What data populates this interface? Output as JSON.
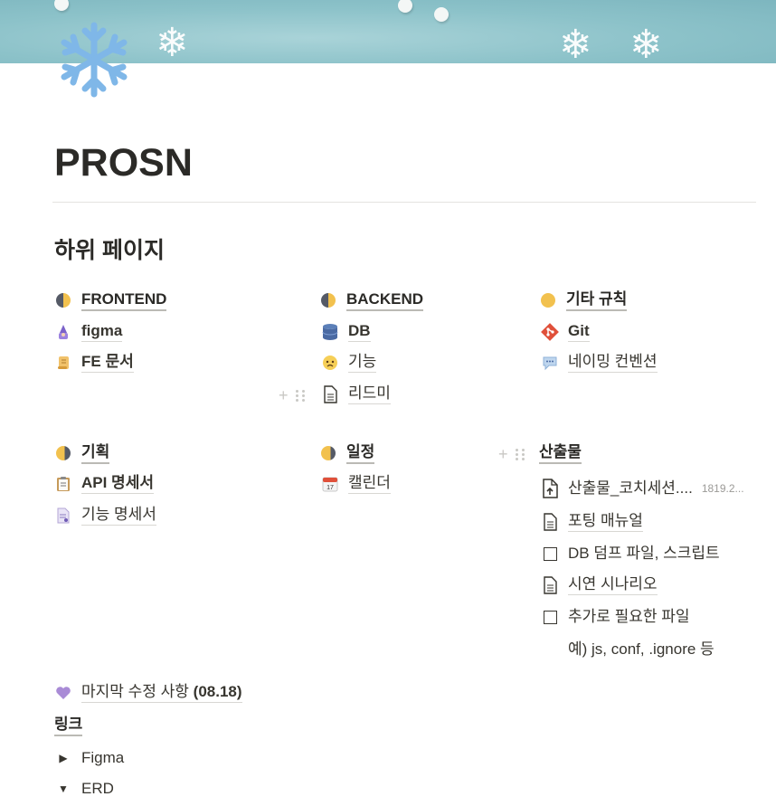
{
  "page": {
    "title": "PROSN"
  },
  "heading": "하위 페이지",
  "columns": {
    "frontend": {
      "label": "FRONTEND",
      "items": [
        {
          "icon": "wizard-icon",
          "label": "figma"
        },
        {
          "icon": "scroll-icon",
          "label": "FE 문서"
        }
      ]
    },
    "backend": {
      "label": "BACKEND",
      "items": [
        {
          "icon": "database-icon",
          "label": "DB"
        },
        {
          "icon": "worried-face-icon",
          "label": "기능"
        },
        {
          "icon": "document-icon",
          "label": "리드미"
        }
      ]
    },
    "etc": {
      "label": "기타 규칙",
      "items": [
        {
          "icon": "git-icon",
          "label": "Git"
        },
        {
          "icon": "speech-bubble-icon",
          "label": "네이밍 컨벤션"
        }
      ]
    },
    "planning": {
      "label": "기획",
      "items": [
        {
          "icon": "clipboard-icon",
          "label": "API 명세서"
        },
        {
          "icon": "page-icon",
          "label": "기능 명세서"
        }
      ]
    },
    "schedule": {
      "label": "일정",
      "items": [
        {
          "icon": "calendar-icon",
          "label": "캘린더"
        }
      ]
    },
    "deliverables": {
      "label": "산출물",
      "file": {
        "name": "산출물_코치세션....",
        "size": "1819.2..."
      },
      "items": [
        {
          "type": "page",
          "label": "포팅 매뉴얼"
        },
        {
          "type": "todo",
          "label": "DB 덤프 파일, 스크립트"
        },
        {
          "type": "page",
          "label": "시연 시나리오"
        },
        {
          "type": "todo",
          "label": "추가로 필요한 파일"
        }
      ],
      "note": "예) js, conf, .ignore 등"
    }
  },
  "last_modified": {
    "label": "마지막 수정 사항",
    "date": "(08.18)"
  },
  "links": {
    "title": "링크",
    "toggles": [
      {
        "label": "Figma",
        "state": "collapsed"
      },
      {
        "label": "ERD",
        "state": "expanded"
      }
    ]
  },
  "colors": {
    "text": "#37352f",
    "cover": "#8cc2c9",
    "icon_snowflake": "#7fb7e8"
  }
}
